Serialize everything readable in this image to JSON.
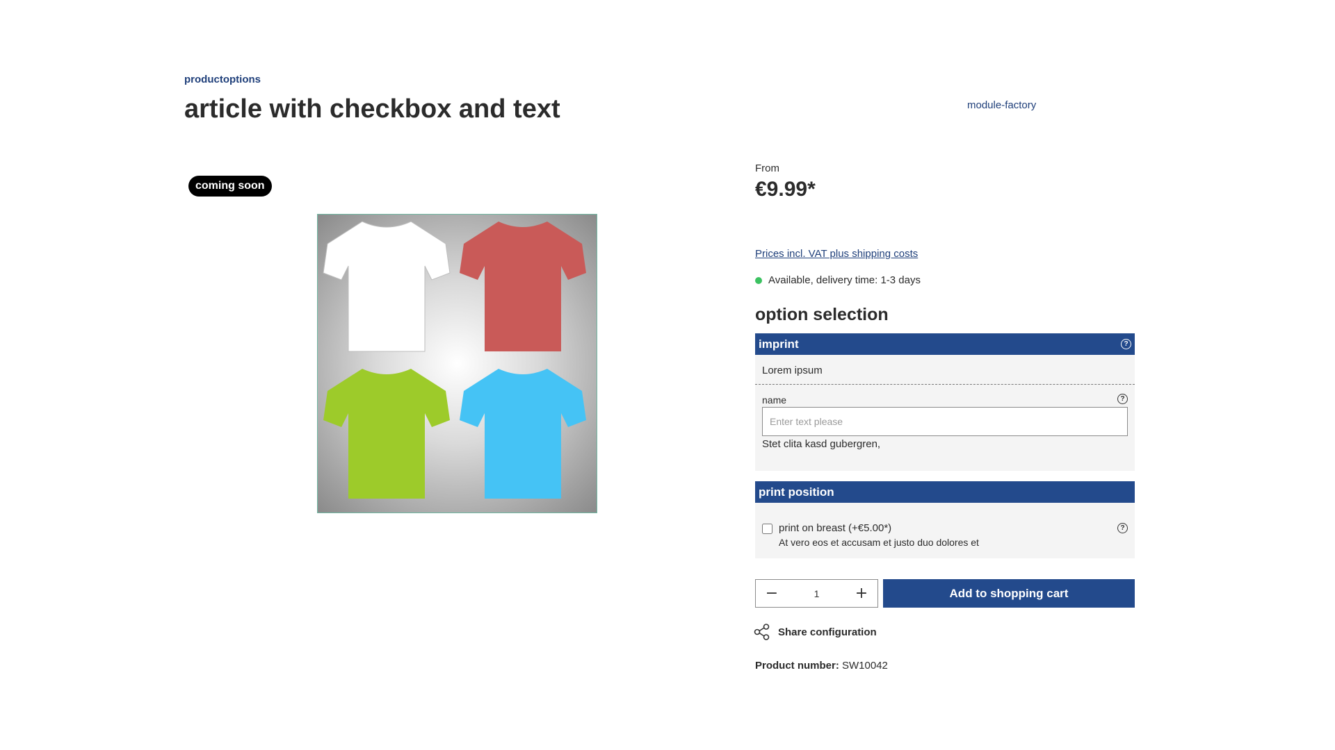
{
  "breadcrumb": "productoptions",
  "product": {
    "title": "article with checkbox and text",
    "manufacturer": "module-factory",
    "badge": "coming soon",
    "price_from": "From",
    "price": "€9.99*",
    "vat_link": "Prices incl. VAT plus shipping costs",
    "availability": "Available, delivery time: 1-3 days",
    "availability_color": "#3cc261",
    "number_label": "Product number:",
    "number_value": "SW10042"
  },
  "options": {
    "heading": "option selection",
    "imprint": {
      "title": "imprint",
      "description": "Lorem ipsum",
      "field_label": "name",
      "placeholder": "Enter text please",
      "hint": "Stet clita kasd gubergren,"
    },
    "print_position": {
      "title": "print position",
      "checkbox_label": "print on breast (+€5.00*)",
      "checkbox_desc": "At vero eos et accusam et justo duo dolores et",
      "checked": false
    }
  },
  "cart": {
    "quantity": "1",
    "minus": "−",
    "plus": "+",
    "add_label": "Add to shopping cart"
  },
  "share_label": "Share configuration",
  "help_glyph": "?",
  "colors": {
    "accent": "#234a8c",
    "link": "#1f3f7a",
    "panel_bg": "#f4f4f4",
    "shirts": [
      "#ffffff",
      "#c95a58",
      "#9dcb2a",
      "#45c3f5"
    ]
  }
}
